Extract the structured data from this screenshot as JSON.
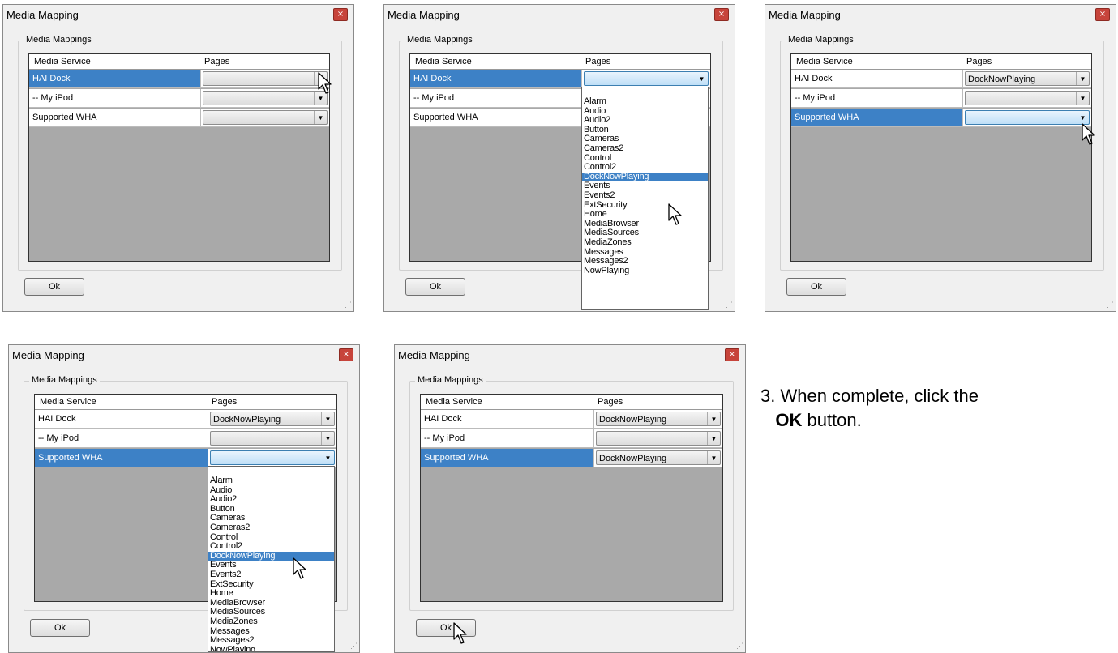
{
  "title": "Media Mapping",
  "group_label": "Media Mappings",
  "columns": [
    "Media Service",
    "Pages"
  ],
  "ok_label": "Ok",
  "close_glyph": "×",
  "dropdown_items": [
    "Alarm",
    "Audio",
    "Audio2",
    "Button",
    "Cameras",
    "Cameras2",
    "Control",
    "Control2",
    "DockNowPlaying",
    "Events",
    "Events2",
    "ExtSecurity",
    "Home",
    "MediaBrowser",
    "MediaSources",
    "MediaZones",
    "Messages",
    "Messages2",
    "NowPlaying"
  ],
  "dropdown_highlight": "DockNowPlaying",
  "dialogs": [
    {
      "rows": [
        {
          "service": "HAI Dock",
          "page": "",
          "selected": true,
          "open": false
        },
        {
          "service": "-- My iPod",
          "page": "",
          "selected": false,
          "open": false
        },
        {
          "service": "Supported WHA",
          "page": "",
          "selected": false,
          "open": false
        }
      ]
    },
    {
      "rows": [
        {
          "service": "HAI Dock",
          "page": "",
          "selected": true,
          "open": true
        },
        {
          "service": "-- My iPod",
          "page": "",
          "selected": false,
          "open": false
        },
        {
          "service": "Supported WHA",
          "page": "",
          "selected": false,
          "open": false
        }
      ]
    },
    {
      "rows": [
        {
          "service": "HAI Dock",
          "page": "DockNowPlaying",
          "selected": false,
          "open": false
        },
        {
          "service": "-- My iPod",
          "page": "",
          "selected": false,
          "open": false
        },
        {
          "service": "Supported WHA",
          "page": "",
          "selected": true,
          "open": true
        }
      ]
    },
    {
      "rows": [
        {
          "service": "HAI Dock",
          "page": "DockNowPlaying",
          "selected": false,
          "open": false
        },
        {
          "service": "-- My iPod",
          "page": "",
          "selected": false,
          "open": false
        },
        {
          "service": "Supported WHA",
          "page": "",
          "selected": true,
          "open": true
        }
      ]
    },
    {
      "rows": [
        {
          "service": "HAI Dock",
          "page": "DockNowPlaying",
          "selected": false,
          "open": false
        },
        {
          "service": "-- My iPod",
          "page": "",
          "selected": false,
          "open": false
        },
        {
          "service": "Supported WHA",
          "page": "DockNowPlaying",
          "selected": true,
          "open": false
        }
      ]
    }
  ],
  "instruction": {
    "prefix": "3. When complete, click the",
    "bold": "OK",
    "suffix": "button."
  }
}
